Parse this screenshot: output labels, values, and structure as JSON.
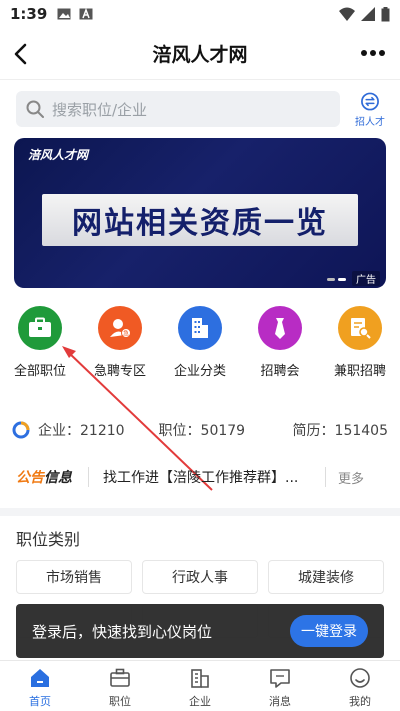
{
  "status_bar": {
    "time": "1:39"
  },
  "nav": {
    "title": "涪风人才网"
  },
  "search": {
    "placeholder": "搜索职位/企业",
    "recruit_label": "招人才"
  },
  "banner": {
    "logo": "涪风人才网",
    "title": "网站相关资质一览",
    "ad_label": "广告"
  },
  "quick_menu": [
    {
      "label": "全部职位",
      "icon": "briefcase-icon",
      "color": "#1f9a3a"
    },
    {
      "label": "急聘专区",
      "icon": "urgent-person-icon",
      "color": "#f05a24"
    },
    {
      "label": "企业分类",
      "icon": "building-icon",
      "color": "#2d6fe0"
    },
    {
      "label": "招聘会",
      "icon": "tie-icon",
      "color": "#b82cc4"
    },
    {
      "label": "兼职招聘",
      "icon": "document-search-icon",
      "color": "#f0a020"
    }
  ],
  "stats": {
    "company": "企业：21210",
    "jobs": "职位：50179",
    "resume": "简历：151405"
  },
  "notice": {
    "tag_a": "公告",
    "tag_b": "信息",
    "text": "找工作进【涪陵工作推荐群】...",
    "more": "更多"
  },
  "job_categories": {
    "heading": "职位类别",
    "items": [
      "市场销售",
      "行政人事",
      "城建装修"
    ]
  },
  "toast": {
    "text": "登录后，快速找到心仪岗位",
    "button": "一键登录"
  },
  "tabs": [
    {
      "label": "首页",
      "icon": "home-icon",
      "active": true
    },
    {
      "label": "职位",
      "icon": "briefcase-icon",
      "active": false
    },
    {
      "label": "企业",
      "icon": "building-icon",
      "active": false
    },
    {
      "label": "消息",
      "icon": "message-icon",
      "active": false
    },
    {
      "label": "我的",
      "icon": "profile-icon",
      "active": false
    }
  ],
  "colors": {
    "accent": "#2a6fe0",
    "annotation": "#e23b3b"
  }
}
